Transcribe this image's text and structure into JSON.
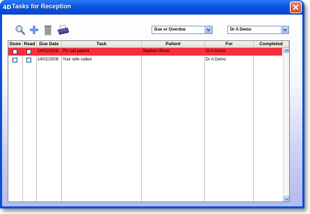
{
  "window": {
    "app_icon_text": "4D",
    "title": "Tasks for Reception"
  },
  "toolbar": {
    "icons": [
      "search-icon",
      "add-icon",
      "trash-icon",
      "print-icon"
    ],
    "filter_select_value": "Due or Overdue",
    "user_select_value": "Dr A Demo"
  },
  "table": {
    "columns": [
      "Done",
      "Read",
      "Due Date",
      "Task",
      "Patient",
      "For",
      "Completed"
    ],
    "rows": [
      {
        "done": false,
        "read": false,
        "due_date": "14/01/2008",
        "task": "Pls call patient",
        "patient": "Stephen Bown",
        "for": "Dr A Demo",
        "completed": "",
        "selected": true
      },
      {
        "done": false,
        "read": false,
        "due_date": "14/01/2008",
        "task": "Your wife called",
        "patient": "",
        "for": "Dr A Demo",
        "completed": "",
        "selected": false
      }
    ]
  },
  "colors": {
    "title_bar": "#0b55e3",
    "selected_row": "#f72f3d",
    "checkbox_border": "#1c5180"
  }
}
